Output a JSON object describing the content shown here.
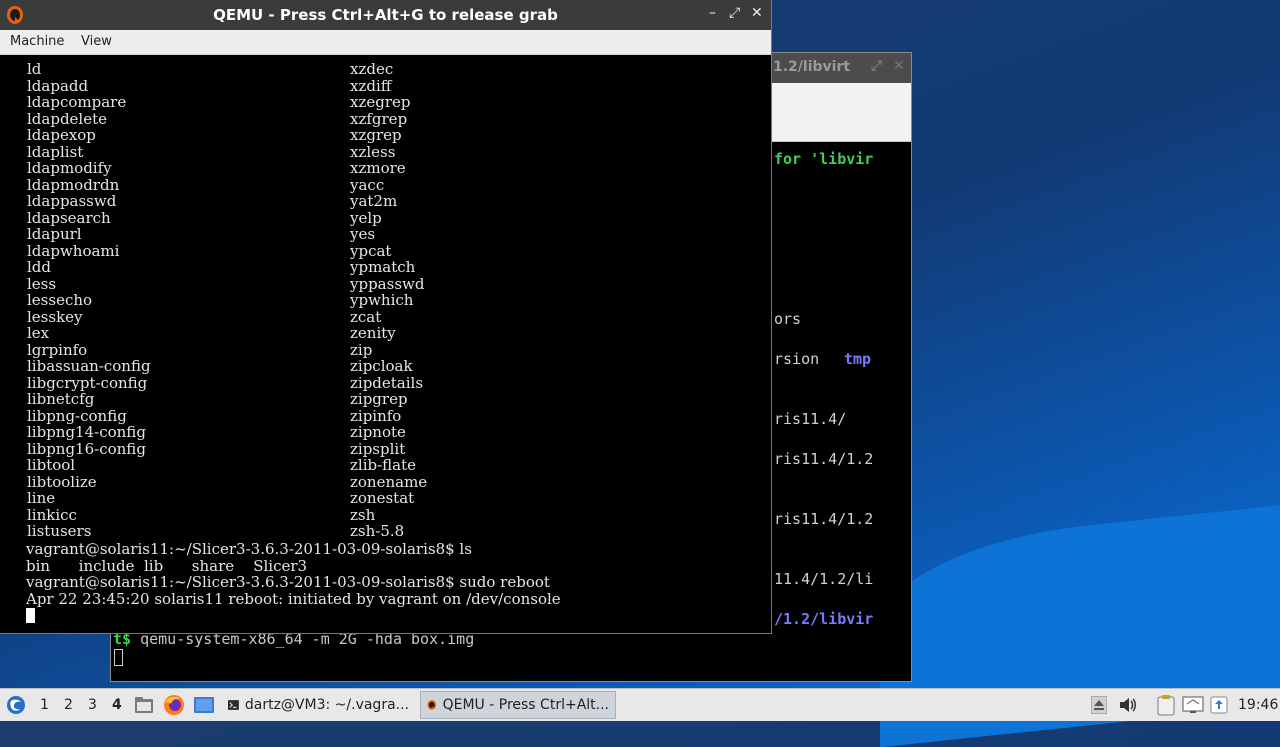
{
  "background_window": {
    "title": "1.2/libvirt",
    "lines": [
      {
        "text": "for 'libvir",
        "style": "hl"
      },
      {
        "text": "ors",
        "style": ""
      },
      {
        "text": "rsion",
        "style": ""
      },
      {
        "text": "tmp",
        "style": "blue"
      },
      {
        "text": "ris11.4/",
        "style": ""
      },
      {
        "text": "ris11.4/1.2",
        "style": ""
      },
      {
        "text": "ris11.4/1.2",
        "style": ""
      },
      {
        "text": "11.4/1.2/li",
        "style": ""
      },
      {
        "text": "/1.2/libvir",
        "style": "blue"
      }
    ],
    "prompt_symbol": "t$",
    "prompt_command": " qemu-system-x86_64 -m 2G -hda box.img"
  },
  "qemu": {
    "title": "QEMU - Press Ctrl+Alt+G to release grab",
    "menu": [
      "Machine",
      "View"
    ],
    "col1": [
      "ld",
      "ldapadd",
      "ldapcompare",
      "ldapdelete",
      "ldapexop",
      "ldaplist",
      "ldapmodify",
      "ldapmodrdn",
      "ldappasswd",
      "ldapsearch",
      "ldapurl",
      "ldapwhoami",
      "ldd",
      "less",
      "lessecho",
      "lesskey",
      "lex",
      "lgrpinfo",
      "libassuan-config",
      "libgcrypt-config",
      "libnetcfg",
      "libpng-config",
      "libpng14-config",
      "libpng16-config",
      "libtool",
      "libtoolize",
      "line",
      "linkicc",
      "listusers"
    ],
    "col2": [
      "xzdec",
      "xzdiff",
      "xzegrep",
      "xzfgrep",
      "xzgrep",
      "xzless",
      "xzmore",
      "yacc",
      "yat2m",
      "yelp",
      "yes",
      "ypcat",
      "ypmatch",
      "yppasswd",
      "ypwhich",
      "zcat",
      "zenity",
      "zip",
      "zipcloak",
      "zipdetails",
      "zipgrep",
      "zipinfo",
      "zipnote",
      "zipsplit",
      "zlib-flate",
      "zonename",
      "zonestat",
      "zsh",
      "zsh-5.8"
    ],
    "tail": [
      "vagrant@solaris11:~/Slicer3-3.6.3-2011-03-09-solaris8$ ls",
      "bin      include  lib      share    Slicer3",
      "vagrant@solaris11:~/Slicer3-3.6.3-2011-03-09-solaris8$ sudo reboot",
      "Apr 22 23:45:20 solaris11 reboot: initiated by vagrant on /dev/console"
    ]
  },
  "taskbar": {
    "workspaces": [
      "1",
      "2",
      "3",
      "4"
    ],
    "active_workspace": "4",
    "tasks": [
      {
        "label": "dartz@VM3: ~/.vagra...",
        "icon": "terminal-icon"
      },
      {
        "label": "QEMU - Press Ctrl+Alt...",
        "icon": "qemu-icon"
      }
    ],
    "clock": "19:46"
  }
}
